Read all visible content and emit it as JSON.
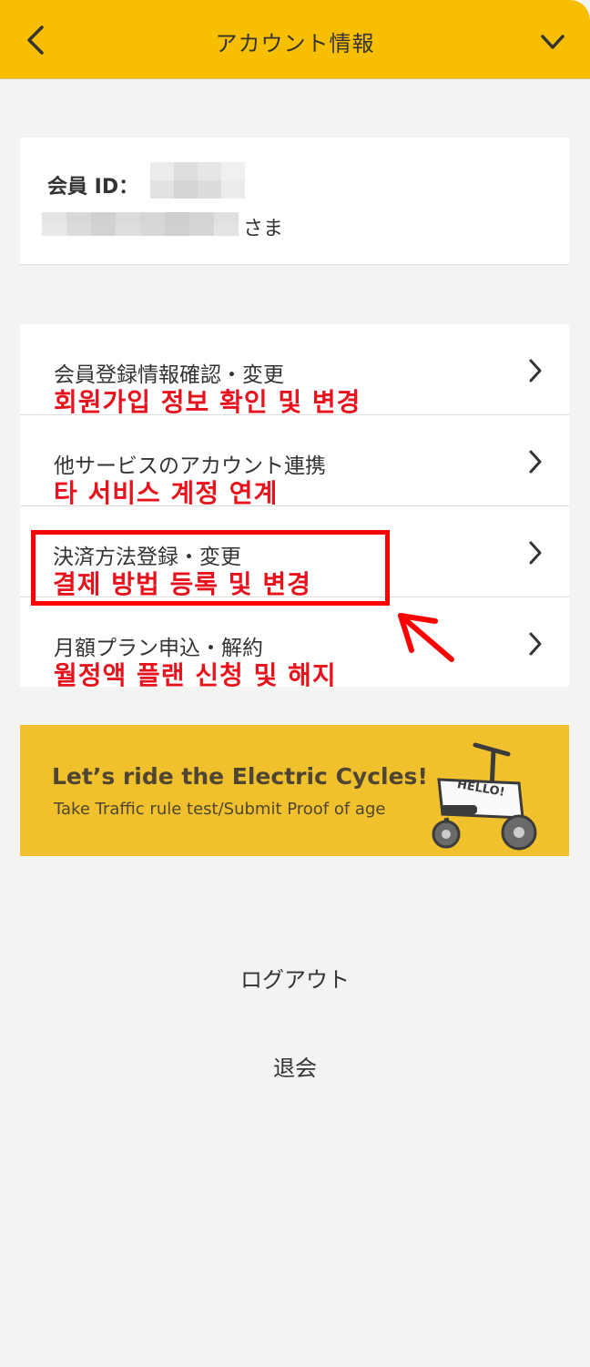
{
  "header": {
    "title": "アカウント情報",
    "back_icon": "chevron-left-icon",
    "expand_icon": "chevron-down-icon",
    "background_color": "#f8bf00"
  },
  "member": {
    "id_label": "会員 ID：",
    "honorific": "さま"
  },
  "menu": {
    "items": [
      {
        "label": "会員登録情報確認・変更",
        "annotation": "회원가입 정보 확인 및 변경"
      },
      {
        "label": "他サービスのアカウント連携",
        "annotation": "타 서비스 계정 연계"
      },
      {
        "label": "決済方法登録・変更",
        "annotation": "결제 방법 등록 및 변경"
      },
      {
        "label": "月額プラン申込・解約",
        "annotation": "월정액 플랜 신청 및 해지"
      }
    ],
    "annotation_color": "#e8121c"
  },
  "banner": {
    "title": "Let’s ride the Electric Cycles!",
    "subtitle": "Take Traffic rule test/Submit Proof of age",
    "bike_text": "HELLO!",
    "background_color": "#f0c02d"
  },
  "footer": {
    "logout_label": "ログアウト",
    "withdraw_label": "退会"
  }
}
